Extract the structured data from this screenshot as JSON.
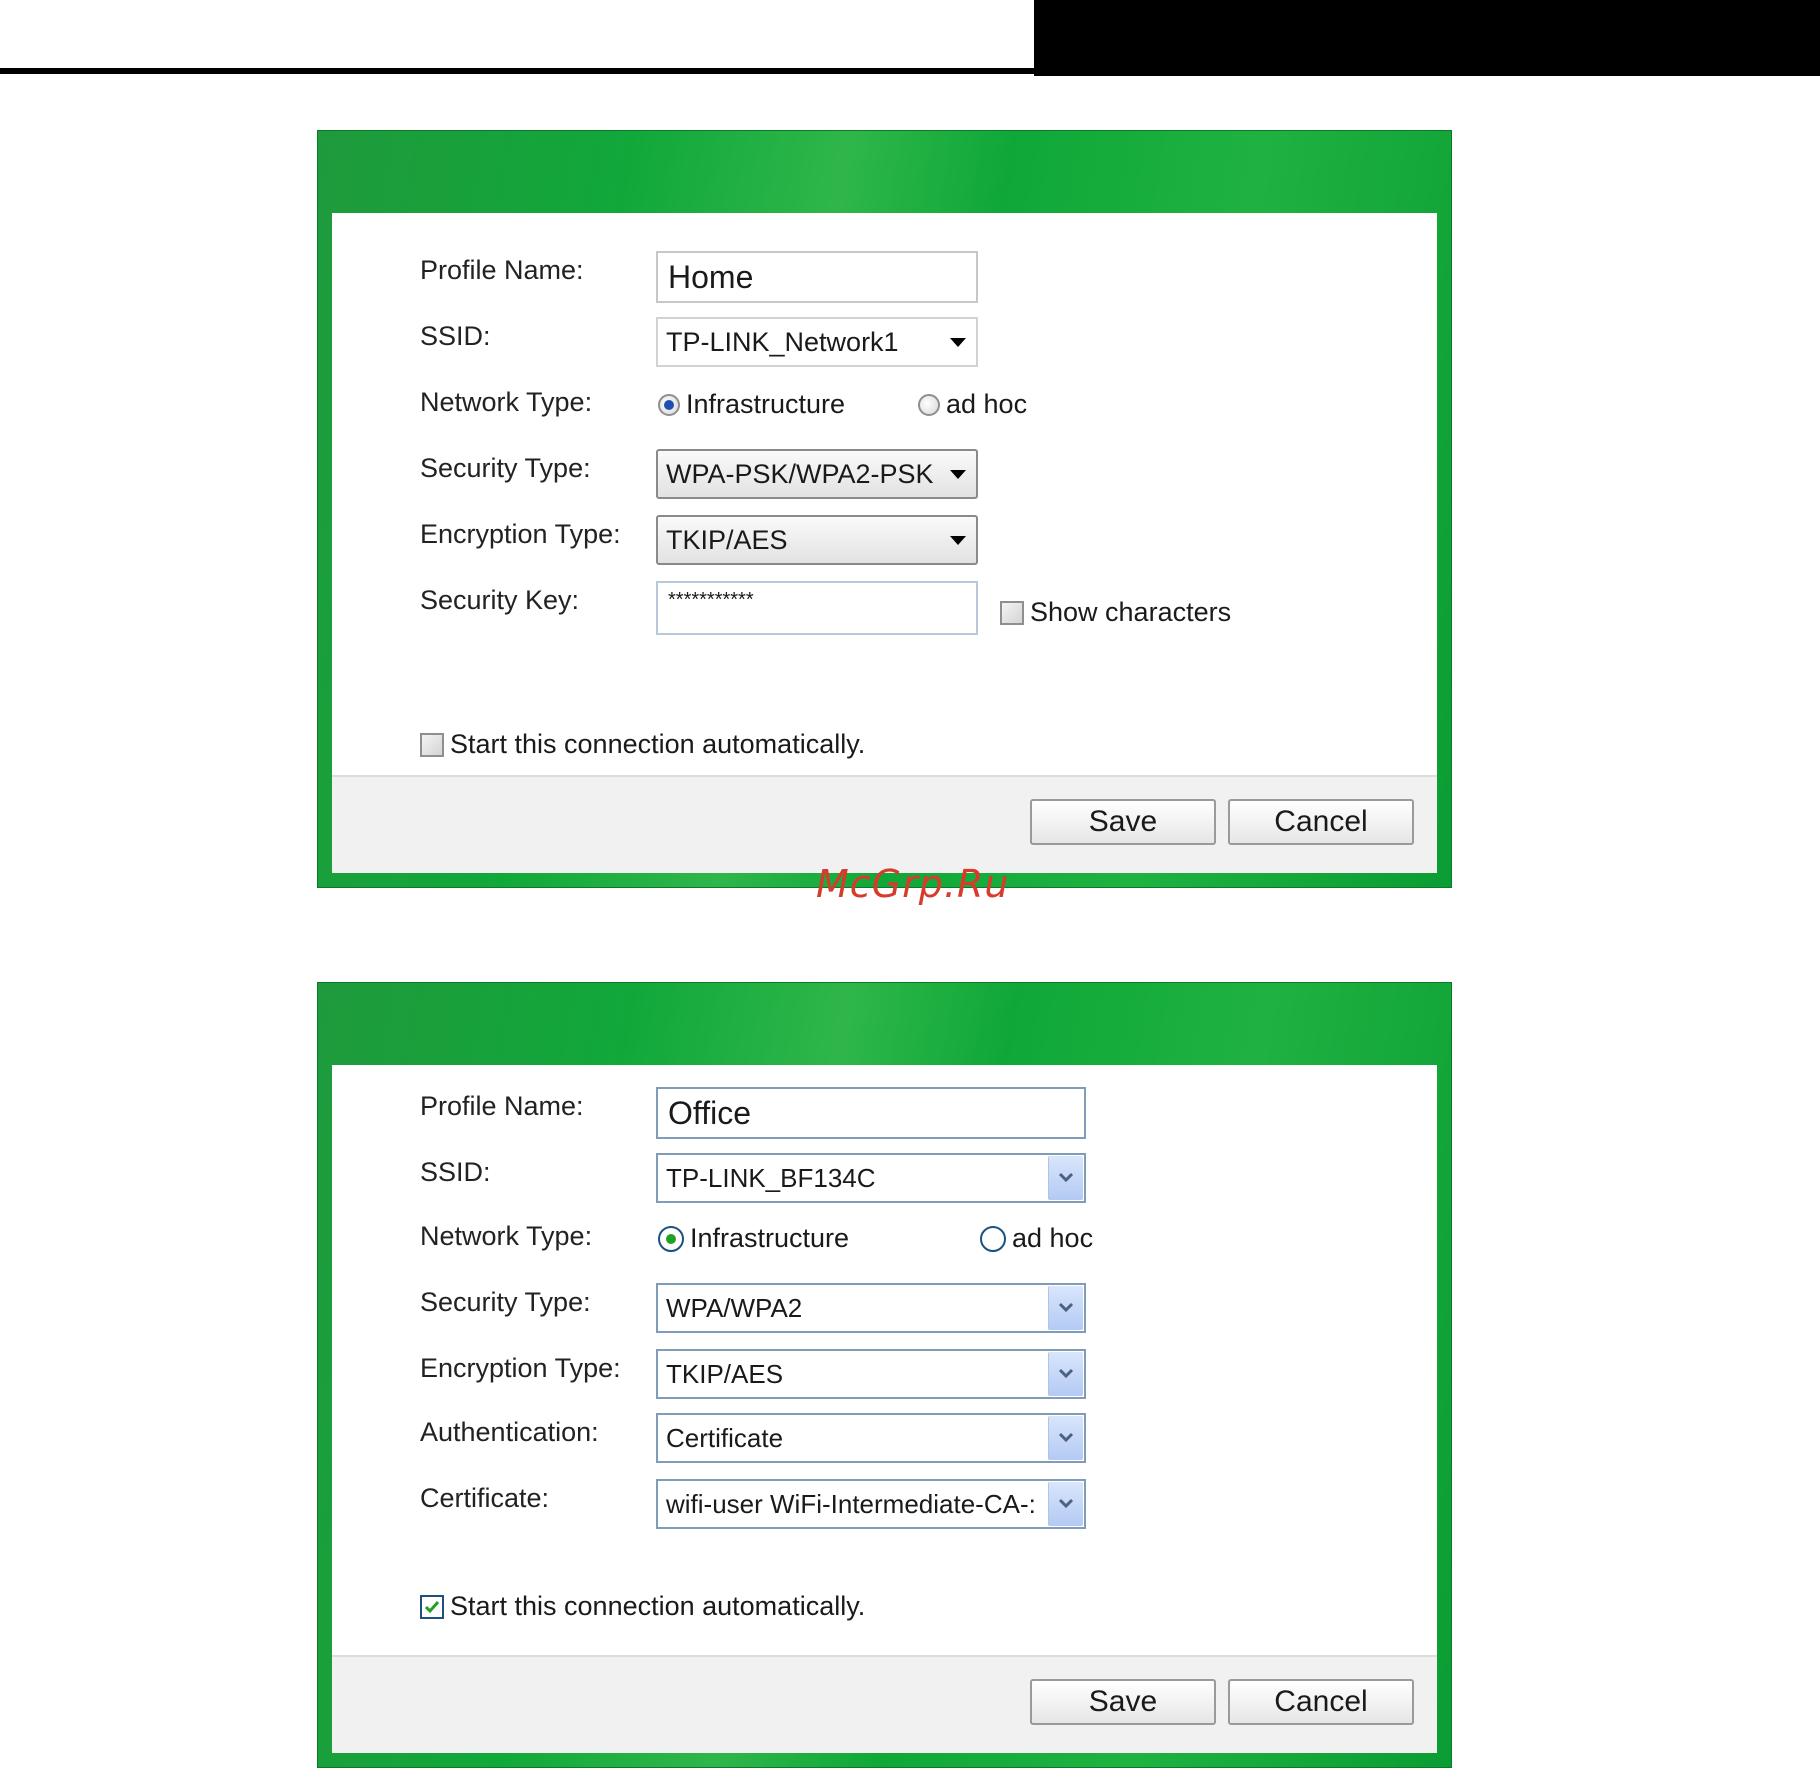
{
  "watermark": "McGrp.Ru",
  "dialog_home": {
    "labels": {
      "profile_name": "Profile Name:",
      "ssid": "SSID:",
      "network_type": "Network Type:",
      "security_type": "Security Type:",
      "encryption_type": "Encryption Type:",
      "security_key": "Security Key:"
    },
    "profile_name_value": "Home",
    "ssid_value": "TP-LINK_Network1",
    "network_type_options": {
      "infrastructure": "Infrastructure",
      "ad_hoc": "ad hoc",
      "selected": "Infrastructure"
    },
    "security_type_value": "WPA-PSK/WPA2-PSK",
    "encryption_type_value": "TKIP/AES",
    "security_key_value": "***********",
    "show_characters_label": "Show characters",
    "show_characters_checked": false,
    "auto_start_label": "Start this connection automatically.",
    "auto_start_checked": false,
    "save_label": "Save",
    "cancel_label": "Cancel"
  },
  "dialog_office": {
    "labels": {
      "profile_name": "Profile Name:",
      "ssid": "SSID:",
      "network_type": "Network Type:",
      "security_type": "Security Type:",
      "encryption_type": "Encryption Type:",
      "authentication": "Authentication:",
      "certificate": "Certificate:"
    },
    "profile_name_value": "Office",
    "ssid_value": "TP-LINK_BF134C",
    "network_type_options": {
      "infrastructure": "Infrastructure",
      "ad_hoc": "ad hoc",
      "selected": "Infrastructure"
    },
    "security_type_value": "WPA/WPA2",
    "encryption_type_value": "TKIP/AES",
    "authentication_value": "Certificate",
    "certificate_value": "wifi-user WiFi-Intermediate-CA-:",
    "auto_start_label": "Start this connection automatically.",
    "auto_start_checked": true,
    "save_label": "Save",
    "cancel_label": "Cancel"
  },
  "colors": {
    "dialog_green": "#11a83a",
    "watermark_red": "#d63b2c",
    "xp_check_green": "#21a121"
  }
}
